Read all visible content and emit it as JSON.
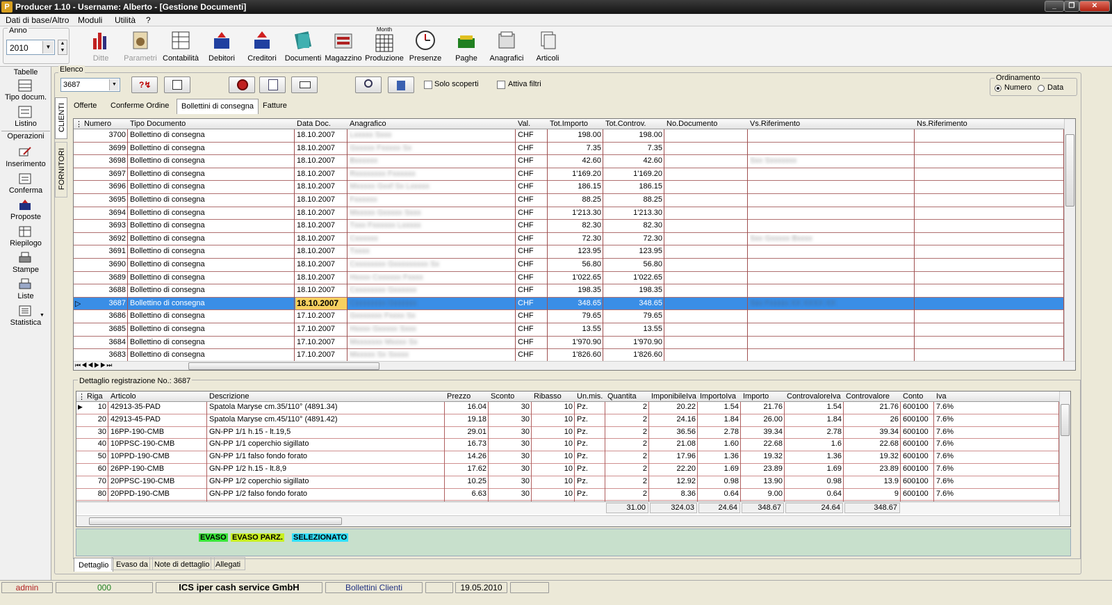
{
  "window": {
    "title": "Producer 1.10 - Username: Alberto - [Gestione Documenti]",
    "logo": "P",
    "minimize": "_",
    "restore": "❐",
    "close": "✕"
  },
  "menu": [
    "Dati di base/Altro",
    "Moduli",
    "Utilità",
    "?"
  ],
  "year": {
    "label": "Anno",
    "value": "2010"
  },
  "toolbar": [
    {
      "label": "Ditte",
      "icon": "bar-chart-icon",
      "disabled": true
    },
    {
      "label": "Parametri",
      "icon": "settings-icon",
      "disabled": true
    },
    {
      "label": "Contabilità",
      "icon": "ledger-icon"
    },
    {
      "label": "Debitori",
      "icon": "inbox-icon"
    },
    {
      "label": "Creditori",
      "icon": "outbox-icon"
    },
    {
      "label": "Documenti",
      "icon": "documents-icon"
    },
    {
      "label": "Magazzino",
      "icon": "warehouse-icon"
    },
    {
      "label": "Produzione",
      "icon": "calendar-icon",
      "sublabel": "Month"
    },
    {
      "label": "Presenze",
      "icon": "clock-icon"
    },
    {
      "label": "Paghe",
      "icon": "money-icon"
    },
    {
      "label": "Anagrafici",
      "icon": "address-book-icon"
    },
    {
      "label": "Articoli",
      "icon": "articles-icon"
    }
  ],
  "left": {
    "tabelle": "Tabelle",
    "tabelle_items": [
      {
        "label": "Tipo docum.",
        "icon": "grid-icon"
      },
      {
        "label": "Listino",
        "icon": "list-icon"
      }
    ],
    "operazioni": "Operazioni",
    "operazioni_items": [
      {
        "label": "Inserimento",
        "icon": "pencil-icon"
      },
      {
        "label": "Conferma",
        "icon": "confirm-icon"
      },
      {
        "label": "Proposte",
        "icon": "card-icon"
      },
      {
        "label": "Riepilogo",
        "icon": "summary-icon"
      },
      {
        "label": "Stampe",
        "icon": "printer-icon"
      },
      {
        "label": "Liste",
        "icon": "printer-list-icon"
      },
      {
        "label": "Statistica",
        "icon": "statistics-icon"
      }
    ]
  },
  "elenco": {
    "label": "Elenco",
    "combo_value": "3687",
    "solo_scoperti": "Solo scoperti",
    "attiva_filtri": "Attiva filtri"
  },
  "ordinamento": {
    "label": "Ordinamento",
    "numero": "Numero",
    "data": "Data"
  },
  "side_tabs": [
    "CLIENTI",
    "FORNITORI"
  ],
  "doc_tabs": [
    "Offerte",
    "Conferme Ordine",
    "Bollettini di consegna",
    "Fatture"
  ],
  "main_grid": {
    "columns": [
      "Numero",
      "Tipo Documento",
      "Data Doc.",
      "Anagrafico",
      "Val.",
      "Tot.Importo",
      "Tot.Controv.",
      "No.Documento",
      "Vs.Riferimento",
      "Ns.Riferimento"
    ],
    "rows": [
      [
        "3700",
        "Bollettino di consegna",
        "18.10.2007",
        "Lxxxxx Sxxx",
        "CHF",
        "198.00",
        "198.00",
        "",
        "",
        ""
      ],
      [
        "3699",
        "Bollettino di consegna",
        "18.10.2007",
        "Gxxxxx Fxxxxx Sx",
        "CHF",
        "7.35",
        "7.35",
        "",
        "",
        ""
      ],
      [
        "3698",
        "Bollettino di consegna",
        "18.10.2007",
        "Bxxxxxx",
        "CHF",
        "42.60",
        "42.60",
        "",
        "Sxx Sxxxxxxx",
        ""
      ],
      [
        "3697",
        "Bollettino di consegna",
        "18.10.2007",
        "Rxxxxxxxx Fxxxxxx",
        "CHF",
        "1'169.20",
        "1'169.20",
        "",
        "",
        ""
      ],
      [
        "3696",
        "Bollettino di consegna",
        "18.10.2007",
        "Mxxxxx Gxxf Sx Lxxxxx",
        "CHF",
        "186.15",
        "186.15",
        "",
        "",
        ""
      ],
      [
        "3695",
        "Bollettino di consegna",
        "18.10.2007",
        "Fxxxxxx",
        "CHF",
        "88.25",
        "88.25",
        "",
        "",
        ""
      ],
      [
        "3694",
        "Bollettino di consegna",
        "18.10.2007",
        "Mxxxxx Gxxxxx Sxxx",
        "CHF",
        "1'213.30",
        "1'213.30",
        "",
        "",
        ""
      ],
      [
        "3693",
        "Bollettino di consegna",
        "18.10.2007",
        "Txxx Fxxxxxx Lxxxxx",
        "CHF",
        "82.30",
        "82.30",
        "",
        "",
        ""
      ],
      [
        "3692",
        "Bollettino di consegna",
        "18.10.2007",
        "Cxxxxxx",
        "CHF",
        "72.30",
        "72.30",
        "",
        "Sxx Gxxxxx Bxxxx",
        ""
      ],
      [
        "3691",
        "Bollettino di consegna",
        "18.10.2007",
        "Txxxx",
        "CHF",
        "123.95",
        "123.95",
        "",
        "",
        ""
      ],
      [
        "3690",
        "Bollettino di consegna",
        "18.10.2007",
        "Cxxxxxxxx Gxxxxxxxxx Sx",
        "CHF",
        "56.80",
        "56.80",
        "",
        "",
        ""
      ],
      [
        "3689",
        "Bollettino di consegna",
        "18.10.2007",
        "Hxxxx Cxxxxxx Fxxxx",
        "CHF",
        "1'022.65",
        "1'022.65",
        "",
        "",
        ""
      ],
      [
        "3688",
        "Bollettino di consegna",
        "18.10.2007",
        "Cxxxxxxxx Gxxxxxx",
        "CHF",
        "198.35",
        "198.35",
        "",
        "",
        ""
      ],
      [
        "3687",
        "Bollettino di consegna",
        "18.10.2007",
        "Cxxxxxxxx Gxxxxxx",
        "CHF",
        "348.65",
        "348.65",
        "",
        "Sxx Fxxxxx XX XXXX XX",
        ""
      ],
      [
        "3686",
        "Bollettino di consegna",
        "17.10.2007",
        "Gxxxxxxx Fxxxx Sx",
        "CHF",
        "79.65",
        "79.65",
        "",
        "",
        ""
      ],
      [
        "3685",
        "Bollettino di consegna",
        "17.10.2007",
        "Hxxxx Gxxxxx Sxxx",
        "CHF",
        "13.55",
        "13.55",
        "",
        "",
        ""
      ],
      [
        "3684",
        "Bollettino di consegna",
        "17.10.2007",
        "Mxxxxxxx Mxxxx Sx",
        "CHF",
        "1'970.90",
        "1'970.90",
        "",
        "",
        ""
      ],
      [
        "3683",
        "Bollettino di consegna",
        "17.10.2007",
        "Mxxxxx Sx Sxxxx",
        "CHF",
        "1'826.60",
        "1'826.60",
        "",
        "",
        ""
      ]
    ],
    "selected_index": 13
  },
  "detail": {
    "label": "Dettaglio registrazione No.: 3687",
    "columns": [
      "Riga",
      "Articolo",
      "Descrizione",
      "Prezzo",
      "Sconto",
      "Ribasso",
      "Un.mis.",
      "Quantita",
      "ImponibileIva",
      "ImportoIva",
      "Importo",
      "ControvaloreIva",
      "Controvalore",
      "Conto",
      "Iva"
    ],
    "rows": [
      [
        "10",
        "42913-35-PAD",
        "Spatola Maryse cm.35/110° (4891.34)",
        "16.04",
        "30",
        "10",
        "Pz.",
        "2",
        "20.22",
        "1.54",
        "21.76",
        "1.54",
        "21.76",
        "600100",
        "7.6%"
      ],
      [
        "20",
        "42913-45-PAD",
        "Spatola Maryse cm.45/110° (4891.42)",
        "19.18",
        "30",
        "10",
        "Pz.",
        "2",
        "24.16",
        "1.84",
        "26.00",
        "1.84",
        "26",
        "600100",
        "7.6%"
      ],
      [
        "30",
        "16PP-190-CMB",
        "GN-PP 1/1 h.15 - lt.19,5",
        "29.01",
        "30",
        "10",
        "Pz.",
        "2",
        "36.56",
        "2.78",
        "39.34",
        "2.78",
        "39.34",
        "600100",
        "7.6%"
      ],
      [
        "40",
        "10PPSC-190-CMB",
        "GN-PP 1/1 coperchio sigillato",
        "16.73",
        "30",
        "10",
        "Pz.",
        "2",
        "21.08",
        "1.60",
        "22.68",
        "1.6",
        "22.68",
        "600100",
        "7.6%"
      ],
      [
        "50",
        "10PPD-190-CMB",
        "GN-PP 1/1 falso fondo forato",
        "14.26",
        "30",
        "10",
        "Pz.",
        "2",
        "17.96",
        "1.36",
        "19.32",
        "1.36",
        "19.32",
        "600100",
        "7.6%"
      ],
      [
        "60",
        "26PP-190-CMB",
        "GN-PP 1/2 h.15 - lt.8,9",
        "17.62",
        "30",
        "10",
        "Pz.",
        "2",
        "22.20",
        "1.69",
        "23.89",
        "1.69",
        "23.89",
        "600100",
        "7.6%"
      ],
      [
        "70",
        "20PPSC-190-CMB",
        "GN-PP 1/2 coperchio sigillato",
        "10.25",
        "30",
        "10",
        "Pz.",
        "2",
        "12.92",
        "0.98",
        "13.90",
        "0.98",
        "13.9",
        "600100",
        "7.6%"
      ],
      [
        "80",
        "20PPD-190-CMB",
        "GN-PP 1/2 falso fondo forato",
        "6.63",
        "30",
        "10",
        "Pz.",
        "2",
        "8.36",
        "0.64",
        "9.00",
        "0.64",
        "9",
        "600100",
        "7.6%"
      ]
    ],
    "totals": {
      "quantita": "31.00",
      "imponibile": "324.03",
      "importo_iva": "24.64",
      "importo": "348.67",
      "controvalore_iva": "24.64",
      "controvalore": "348.67"
    }
  },
  "legend": [
    {
      "label": "EVASO",
      "color": "#39e639"
    },
    {
      "label": "EVASO PARZ.",
      "color": "#c8f020"
    },
    {
      "label": "SELEZIONATO",
      "color": "#30e0ff"
    }
  ],
  "bottom_tabs": [
    "Dettaglio",
    "Evaso da",
    "Note di dettaglio",
    "Allegati"
  ],
  "status": {
    "user": "admin",
    "code": "000",
    "company": "ICS iper cash service GmbH",
    "module": "Bollettini Clienti",
    "date": "19.05.2010"
  },
  "colors": {
    "selection": "#3a8ee6",
    "date_highlight": "#f7d060",
    "legend_bg": "#c8e0cc"
  }
}
